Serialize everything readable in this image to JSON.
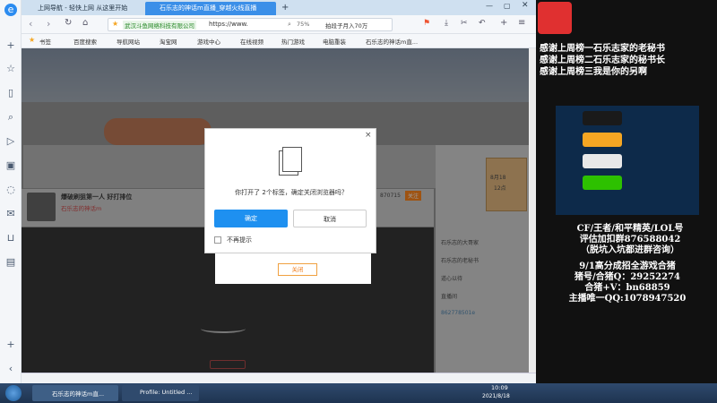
{
  "browser": {
    "tabs": [
      {
        "label": "上网导航 - 轻快上网 从这里开始"
      },
      {
        "label": "石乐志的神话m直播_穿越火线直播"
      }
    ],
    "address": {
      "site_label": "武汉斗鱼网络科技有限公司",
      "url": "https://www.",
      "zoom": "75%",
      "search": "拍段子月入70万"
    },
    "bookmarks": [
      "书签",
      "百度搜索",
      "导航网站",
      "淘宝网",
      "游戏中心",
      "在线视频",
      "热门游戏",
      "电脑重装",
      "石乐志的神话m直..."
    ]
  },
  "dialog": {
    "message": "你打开了 2个标签，确定关闭浏览器吗？",
    "ok_label": "确定",
    "cancel_label": "取消",
    "dont_show_label": "不再提示",
    "close_label": "×",
    "secondary_label": "关闭"
  },
  "page": {
    "streamer_title": "爆破刷狙第一人 好打排位",
    "streamer_name": "石乐志的神话m",
    "follow_label": "关注",
    "fans": "870715",
    "chat_items": [
      {
        "name": "石乐志的大哥家",
        "color": "#d9a02a"
      },
      {
        "name": "石乐志的老秘书",
        "color": "#3aa0d8"
      },
      {
        "name": "道心以待",
        "color": "#b56ae0"
      },
      {
        "name": "直播间",
        "color": "#3aa0d8"
      },
      {
        "name": "862778501e",
        "color": "#3aa0d8"
      }
    ],
    "date_badge": "8月18",
    "time_badge": "12点"
  },
  "right_panel": {
    "thanks": [
      "感谢上周榜一石乐志家的老秘书",
      "感谢上周榜二石乐志家的秘书长",
      "感谢上周榜三我是你的另啊"
    ],
    "info": [
      "CF/王者/和平精英/LOL号",
      "评估加扣群876588042",
      "（脱坑入坑都进群咨询）",
      "9/1高分成招全游戏合猪",
      "猪号/合猪Q：29252274",
      "合猪+V：bn68859",
      "主播唯一QQ:1078947520"
    ],
    "social": [
      {
        "icon": "tiktok-icon",
        "color": "#ffffff"
      },
      {
        "icon": "kuaishou-icon",
        "color": "#f5a623"
      },
      {
        "icon": "weibo-icon",
        "color": "#ffffff"
      },
      {
        "icon": "wechat-icon",
        "color": "#2dc100"
      }
    ]
  },
  "taskbar": {
    "items": [
      "石乐志的神话m直...",
      "Profile: Untitled ..."
    ],
    "time": "10:09",
    "date": "2021/8/18"
  }
}
